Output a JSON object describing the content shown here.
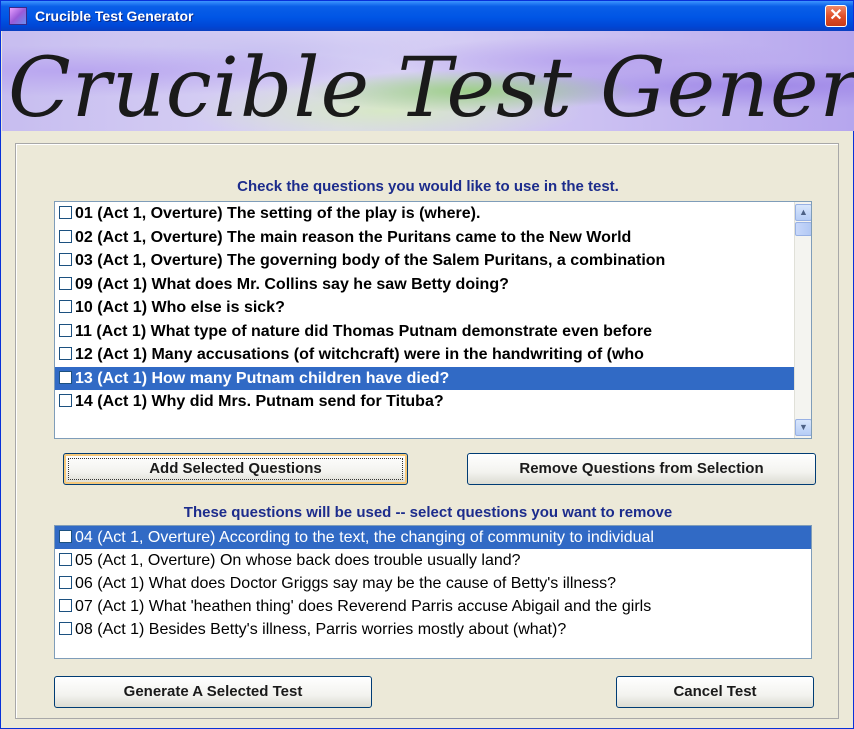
{
  "window": {
    "title": "Crucible Test Generator",
    "close_glyph": "✕"
  },
  "banner": {
    "text": "Crucible Test Generator"
  },
  "available": {
    "instruction": "Check the questions you would like to use in the test.",
    "items": [
      {
        "label": "01 (Act 1, Overture) The setting of the play is (where).",
        "checked": false,
        "selected": false
      },
      {
        "label": "02 (Act 1, Overture) The main reason the Puritans came to the New World",
        "checked": false,
        "selected": false
      },
      {
        "label": "03 (Act 1, Overture) The governing body of the Salem Puritans, a combination",
        "checked": false,
        "selected": false
      },
      {
        "label": "09 (Act 1) What does Mr. Collins say he saw Betty doing?",
        "checked": false,
        "selected": false
      },
      {
        "label": "10 (Act 1) Who else is sick?",
        "checked": false,
        "selected": false
      },
      {
        "label": "11 (Act 1) What type of nature did Thomas Putnam demonstrate even before",
        "checked": false,
        "selected": false
      },
      {
        "label": "12 (Act 1) Many accusations (of witchcraft) were in the handwriting of (who",
        "checked": false,
        "selected": false
      },
      {
        "label": "13 (Act 1) How many Putnam children have died?",
        "checked": false,
        "selected": true
      },
      {
        "label": "14 (Act 1) Why did Mrs. Putnam send for Tituba?",
        "checked": false,
        "selected": false
      }
    ]
  },
  "buttons": {
    "add": "Add Selected Questions",
    "remove": "Remove Questions from Selection",
    "generate": "Generate A Selected Test",
    "cancel": "Cancel Test"
  },
  "selected": {
    "instruction": "These questions will be used --  select questions you want to remove",
    "items": [
      {
        "label": "04 (Act 1, Overture) According to the text, the changing of community to individual",
        "selected": true
      },
      {
        "label": "05 (Act 1, Overture) On whose back does trouble usually land?",
        "selected": false
      },
      {
        "label": "06 (Act 1) What does Doctor Griggs say may be the cause of Betty's illness?",
        "selected": false
      },
      {
        "label": "07 (Act 1) What 'heathen thing' does Reverend Parris accuse Abigail and the girls",
        "selected": false
      },
      {
        "label": "08 (Act 1) Besides Betty's illness, Parris worries mostly about (what)?",
        "selected": false
      }
    ]
  },
  "colors": {
    "selection": "#316ac5",
    "titlebar": "#0055e5",
    "instruction_text": "#1c2c8c"
  }
}
